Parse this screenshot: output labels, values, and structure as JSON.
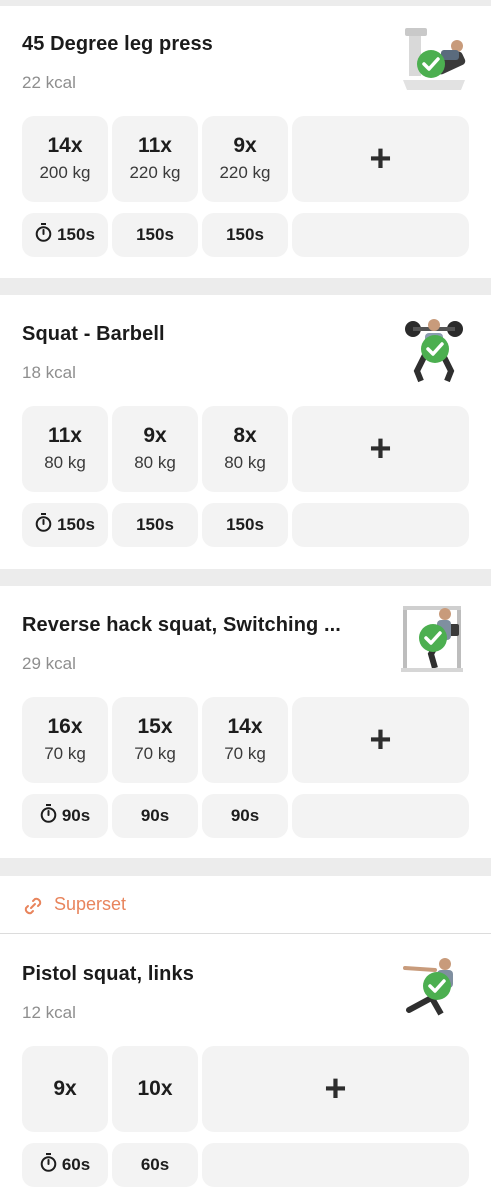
{
  "exercises": [
    {
      "title": "45 Degree leg press",
      "kcal": "22 kcal",
      "thumb_icon": "leg-press-machine-icon",
      "sets": [
        {
          "reps": "14x",
          "weight": "200 kg",
          "rest": "150s"
        },
        {
          "reps": "11x",
          "weight": "220 kg",
          "rest": "150s"
        },
        {
          "reps": "9x",
          "weight": "220 kg",
          "rest": "150s"
        }
      ],
      "add_label": "+"
    },
    {
      "title": "Squat - Barbell",
      "kcal": "18 kcal",
      "thumb_icon": "barbell-squat-icon",
      "sets": [
        {
          "reps": "11x",
          "weight": "80 kg",
          "rest": "150s"
        },
        {
          "reps": "9x",
          "weight": "80 kg",
          "rest": "150s"
        },
        {
          "reps": "8x",
          "weight": "80 kg",
          "rest": "150s"
        }
      ],
      "add_label": "+"
    },
    {
      "title": "Reverse hack squat, Switching ...",
      "kcal": "29 kcal",
      "thumb_icon": "hack-squat-machine-icon",
      "sets": [
        {
          "reps": "16x",
          "weight": "70 kg",
          "rest": "90s"
        },
        {
          "reps": "15x",
          "weight": "70 kg",
          "rest": "90s"
        },
        {
          "reps": "14x",
          "weight": "70 kg",
          "rest": "90s"
        }
      ],
      "add_label": "+"
    },
    {
      "title": "Pistol squat, links",
      "kcal": "12 kcal",
      "thumb_icon": "pistol-squat-icon",
      "sets": [
        {
          "reps": "9x",
          "rest": "60s"
        },
        {
          "reps": "10x",
          "rest": "60s"
        }
      ],
      "add_label": "+"
    }
  ],
  "superset": {
    "label": "Superset",
    "icon": "link-icon"
  },
  "colors": {
    "accent": "#e8845c",
    "check": "#4caf50",
    "tile": "#f3f3f3"
  }
}
